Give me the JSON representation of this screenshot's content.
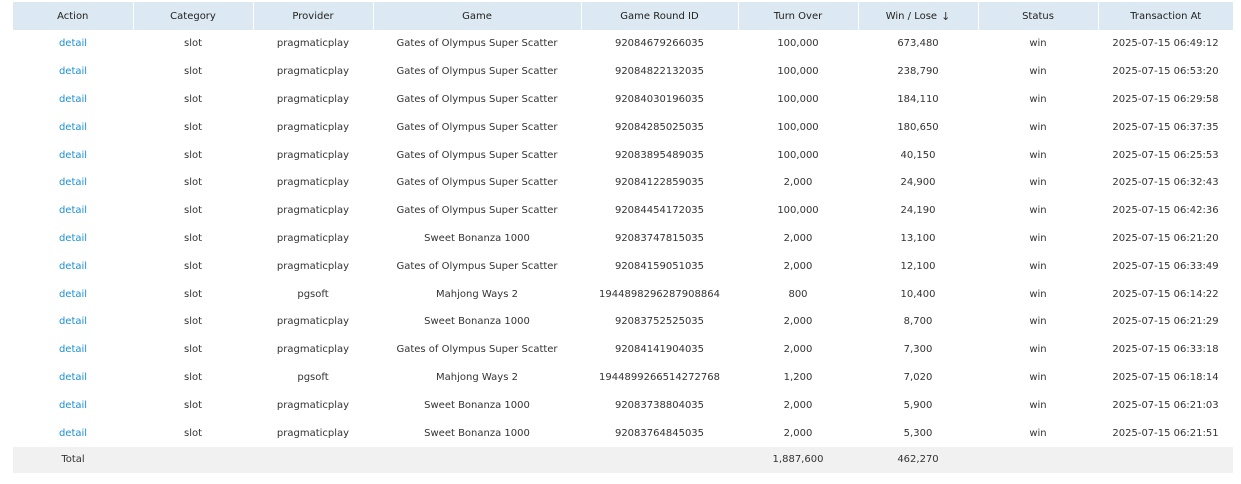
{
  "columns": [
    {
      "key": "action",
      "label": "Action"
    },
    {
      "key": "category",
      "label": "Category"
    },
    {
      "key": "provider",
      "label": "Provider"
    },
    {
      "key": "game",
      "label": "Game"
    },
    {
      "key": "round_id",
      "label": "Game Round ID"
    },
    {
      "key": "turn_over",
      "label": "Turn Over"
    },
    {
      "key": "win_lose",
      "label": "Win / Lose"
    },
    {
      "key": "status",
      "label": "Status"
    },
    {
      "key": "transaction_at",
      "label": "Transaction At"
    }
  ],
  "sort": {
    "column": "win_lose",
    "direction": "desc",
    "icon": "arrow-down-icon"
  },
  "colors": {
    "header_bg": "#dde9f2",
    "link": "#1a8fd6",
    "footer_bg": "#f1f1f1"
  },
  "rows": [
    {
      "action": "detail",
      "category": "slot",
      "provider": "pragmaticplay",
      "game": "Gates of Olympus Super Scatter",
      "round_id": "92084679266035",
      "turn_over": "100,000",
      "win_lose": "673,480",
      "status": "win",
      "transaction_at": "2025-07-15 06:49:12"
    },
    {
      "action": "detail",
      "category": "slot",
      "provider": "pragmaticplay",
      "game": "Gates of Olympus Super Scatter",
      "round_id": "92084822132035",
      "turn_over": "100,000",
      "win_lose": "238,790",
      "status": "win",
      "transaction_at": "2025-07-15 06:53:20"
    },
    {
      "action": "detail",
      "category": "slot",
      "provider": "pragmaticplay",
      "game": "Gates of Olympus Super Scatter",
      "round_id": "92084030196035",
      "turn_over": "100,000",
      "win_lose": "184,110",
      "status": "win",
      "transaction_at": "2025-07-15 06:29:58"
    },
    {
      "action": "detail",
      "category": "slot",
      "provider": "pragmaticplay",
      "game": "Gates of Olympus Super Scatter",
      "round_id": "92084285025035",
      "turn_over": "100,000",
      "win_lose": "180,650",
      "status": "win",
      "transaction_at": "2025-07-15 06:37:35"
    },
    {
      "action": "detail",
      "category": "slot",
      "provider": "pragmaticplay",
      "game": "Gates of Olympus Super Scatter",
      "round_id": "92083895489035",
      "turn_over": "100,000",
      "win_lose": "40,150",
      "status": "win",
      "transaction_at": "2025-07-15 06:25:53"
    },
    {
      "action": "detail",
      "category": "slot",
      "provider": "pragmaticplay",
      "game": "Gates of Olympus Super Scatter",
      "round_id": "92084122859035",
      "turn_over": "2,000",
      "win_lose": "24,900",
      "status": "win",
      "transaction_at": "2025-07-15 06:32:43"
    },
    {
      "action": "detail",
      "category": "slot",
      "provider": "pragmaticplay",
      "game": "Gates of Olympus Super Scatter",
      "round_id": "92084454172035",
      "turn_over": "100,000",
      "win_lose": "24,190",
      "status": "win",
      "transaction_at": "2025-07-15 06:42:36"
    },
    {
      "action": "detail",
      "category": "slot",
      "provider": "pragmaticplay",
      "game": "Sweet Bonanza 1000",
      "round_id": "92083747815035",
      "turn_over": "2,000",
      "win_lose": "13,100",
      "status": "win",
      "transaction_at": "2025-07-15 06:21:20"
    },
    {
      "action": "detail",
      "category": "slot",
      "provider": "pragmaticplay",
      "game": "Gates of Olympus Super Scatter",
      "round_id": "92084159051035",
      "turn_over": "2,000",
      "win_lose": "12,100",
      "status": "win",
      "transaction_at": "2025-07-15 06:33:49"
    },
    {
      "action": "detail",
      "category": "slot",
      "provider": "pgsoft",
      "game": "Mahjong Ways 2",
      "round_id": "1944898296287908864",
      "turn_over": "800",
      "win_lose": "10,400",
      "status": "win",
      "transaction_at": "2025-07-15 06:14:22"
    },
    {
      "action": "detail",
      "category": "slot",
      "provider": "pragmaticplay",
      "game": "Sweet Bonanza 1000",
      "round_id": "92083752525035",
      "turn_over": "2,000",
      "win_lose": "8,700",
      "status": "win",
      "transaction_at": "2025-07-15 06:21:29"
    },
    {
      "action": "detail",
      "category": "slot",
      "provider": "pragmaticplay",
      "game": "Gates of Olympus Super Scatter",
      "round_id": "92084141904035",
      "turn_over": "2,000",
      "win_lose": "7,300",
      "status": "win",
      "transaction_at": "2025-07-15 06:33:18"
    },
    {
      "action": "detail",
      "category": "slot",
      "provider": "pgsoft",
      "game": "Mahjong Ways 2",
      "round_id": "1944899266514272768",
      "turn_over": "1,200",
      "win_lose": "7,020",
      "status": "win",
      "transaction_at": "2025-07-15 06:18:14"
    },
    {
      "action": "detail",
      "category": "slot",
      "provider": "pragmaticplay",
      "game": "Sweet Bonanza 1000",
      "round_id": "92083738804035",
      "turn_over": "2,000",
      "win_lose": "5,900",
      "status": "win",
      "transaction_at": "2025-07-15 06:21:03"
    },
    {
      "action": "detail",
      "category": "slot",
      "provider": "pragmaticplay",
      "game": "Sweet Bonanza 1000",
      "round_id": "92083764845035",
      "turn_over": "2,000",
      "win_lose": "5,300",
      "status": "win",
      "transaction_at": "2025-07-15 06:21:51"
    }
  ],
  "totals": {
    "label": "Total",
    "turn_over": "1,887,600",
    "win_lose": "462,270"
  }
}
